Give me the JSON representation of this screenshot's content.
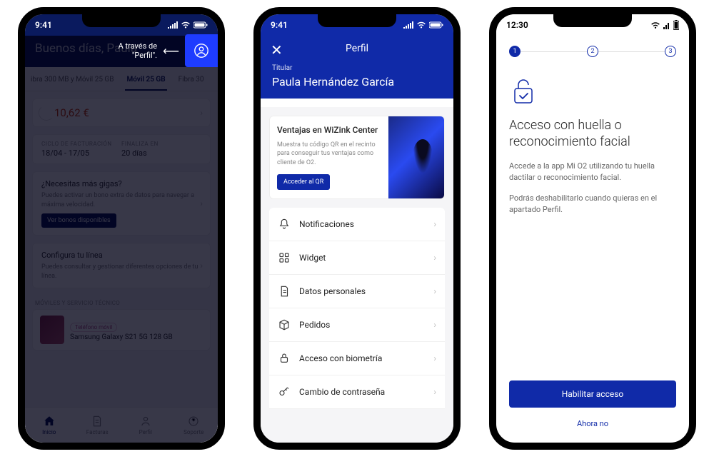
{
  "phone1": {
    "status_time": "9:41",
    "callout_line1": "A través de",
    "callout_line2": "\"Perfil\".",
    "greeting": "Buenos días, Paula",
    "tabs": [
      "ibra 300 MB y Móvil 25 GB",
      "Móvil 25 GB",
      "Fibra 30"
    ],
    "price": "10,62 €",
    "billing_label": "CICLO DE FACTURACIÓN",
    "billing_value": "18/04 - 17/05",
    "ends_label": "FINALIZA EN",
    "ends_value": "20 días",
    "gigas_title": "¿Necesitas más gigas?",
    "gigas_text": "Puedes activar un bono extra de datos para navegar a máxima velocidad.",
    "gigas_btn": "Ver bonos disponibles",
    "config_title": "Configura tu línea",
    "config_text": "Puedes consultar y gestionar diferentes opciones de tu línea.",
    "section_label": "MÓVILES Y SERVICIO TÉCNICO",
    "product_tag": "Teléfono móvil",
    "product_name": "Samsung Galaxy S21 5G 128 GB",
    "nav": [
      "Inicio",
      "Facturas",
      "Perfil",
      "Soporte"
    ]
  },
  "phone2": {
    "status_time": "9:41",
    "title": "Perfil",
    "holder_label": "Titular",
    "holder_name": "Paula Hernández García",
    "promo_title": "Ventajas en WiZink Center",
    "promo_desc": "Muestra tu código QR en el recinto para conseguir tus ventajas como cliente de O2.",
    "promo_btn": "Acceder al QR",
    "items": [
      {
        "label": "Notificaciones",
        "icon": "bell"
      },
      {
        "label": "Widget",
        "icon": "grid"
      },
      {
        "label": "Datos personales",
        "icon": "doc"
      },
      {
        "label": "Pedidos",
        "icon": "box"
      },
      {
        "label": "Acceso con biometría",
        "icon": "lock"
      },
      {
        "label": "Cambio de contraseña",
        "icon": "key"
      }
    ]
  },
  "phone3": {
    "status_time": "12:30",
    "steps": [
      "1",
      "2",
      "3"
    ],
    "heading": "Acceso con huella o reconocimiento facial",
    "p1": "Accede a la app Mi O2 utilizando tu huella dactilar o reconocimiento facial.",
    "p2": "Podrás deshabilitarlo cuando quieras en el apartado Perfil.",
    "primary_btn": "Habilitar acceso",
    "secondary_link": "Ahora no"
  }
}
